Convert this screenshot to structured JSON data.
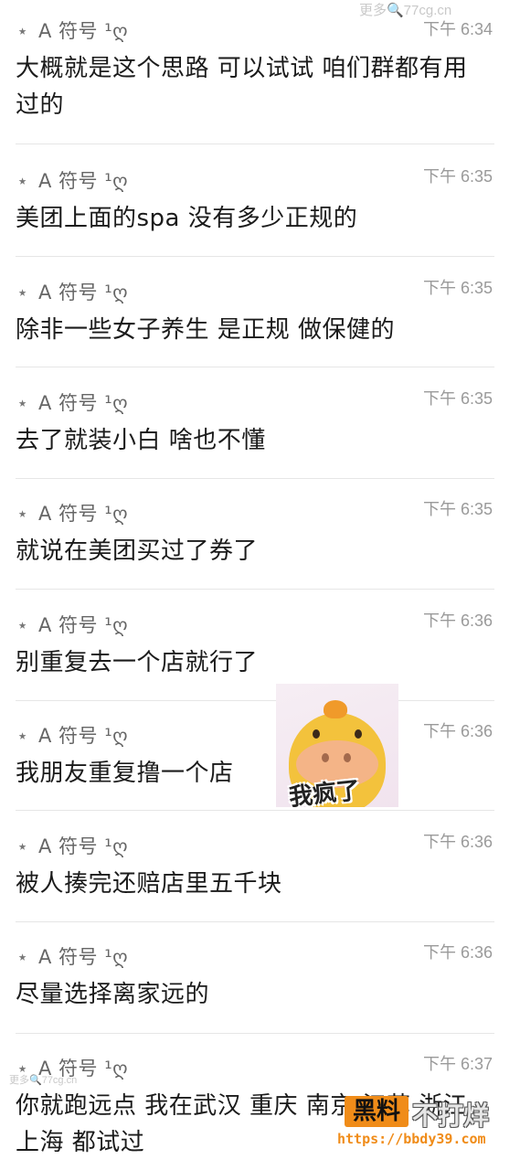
{
  "watermark_top": "更多🔍77cg.cn",
  "sender_name": "A 符号 ¹ღ",
  "messages": [
    {
      "time": "下午 6:34",
      "text": "大概就是这个思路 可以试试 咱们群都有用过的"
    },
    {
      "time": "下午 6:35",
      "text": "美团上面的spa 没有多少正规的"
    },
    {
      "time": "下午 6:35",
      "text": "除非一些女子养生 是正规 做保健的"
    },
    {
      "time": "下午 6:35",
      "text": "去了就装小白 啥也不懂"
    },
    {
      "time": "下午 6:35",
      "text": "就说在美团买过了券了"
    },
    {
      "time": "下午 6:36",
      "text": "别重复去一个店就行了"
    },
    {
      "time": "下午 6:36",
      "text": "我朋友重复撸一个店"
    },
    {
      "time": "下午 6:36",
      "text": "被人揍完还赔店里五千块"
    },
    {
      "time": "下午 6:36",
      "text": "尽量选择离家远的"
    },
    {
      "time": "下午 6:37",
      "text": "你就跑远点 我在武汉 重庆 南京 江苏 浙江 上海 都试过"
    }
  ],
  "sticker": {
    "caption": "我疯了"
  },
  "watermark_bottom_left": "更多🔍77cg.cn",
  "brand": {
    "badge": "黑料",
    "slogan": "不打烊",
    "url": "https://bbdy39.com"
  },
  "colors": {
    "brand_orange": "#f08c19",
    "time_gray": "#9a9a9a",
    "sender_gray": "#666666"
  }
}
